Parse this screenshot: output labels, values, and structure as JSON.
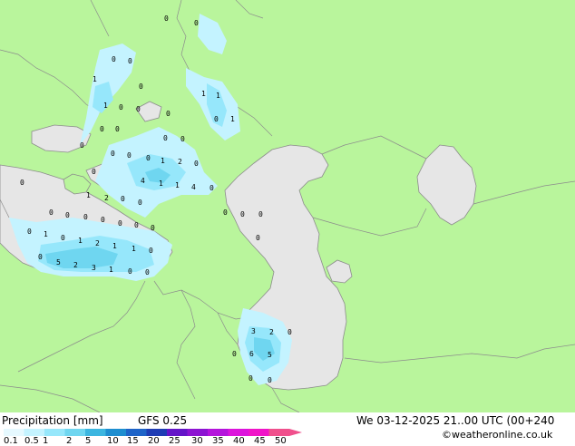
{
  "title": "Precipitation [mm]",
  "model": "GFS 0.25",
  "valid_time": "We 03-12-2025 21..00 UTC (00+240",
  "credit": "©weatheronline.co.uk",
  "colors": {
    "land": "#b9f59c",
    "water": "#e6e6e6",
    "border": "#8c8c8c",
    "precip_light": "#c4f3ff",
    "precip_1": "#96e7fb",
    "precip_2": "#6fd6f0",
    "precip_5": "#3cb6e0"
  },
  "legend": {
    "ticks": [
      "0.1",
      "0.5",
      "1",
      "2",
      "5",
      "10",
      "15",
      "20",
      "25",
      "30",
      "35",
      "40",
      "45",
      "50"
    ],
    "colors": [
      "#e6f9ff",
      "#c4f3ff",
      "#96e7fb",
      "#6fd6f0",
      "#3cb6e0",
      "#1e8ed0",
      "#1e64c8",
      "#1e3cb4",
      "#6414c8",
      "#8c14d2",
      "#b414dc",
      "#dc14dc",
      "#f014c8",
      "#f0508c"
    ]
  },
  "grid_values": [
    {
      "text": "0",
      "lon": 0,
      "lat": 0
    },
    {
      "text": "1"
    },
    {
      "text": "2"
    },
    {
      "text": "4"
    },
    {
      "text": "5"
    },
    {
      "text": "6"
    },
    {
      "text": "3"
    }
  ]
}
